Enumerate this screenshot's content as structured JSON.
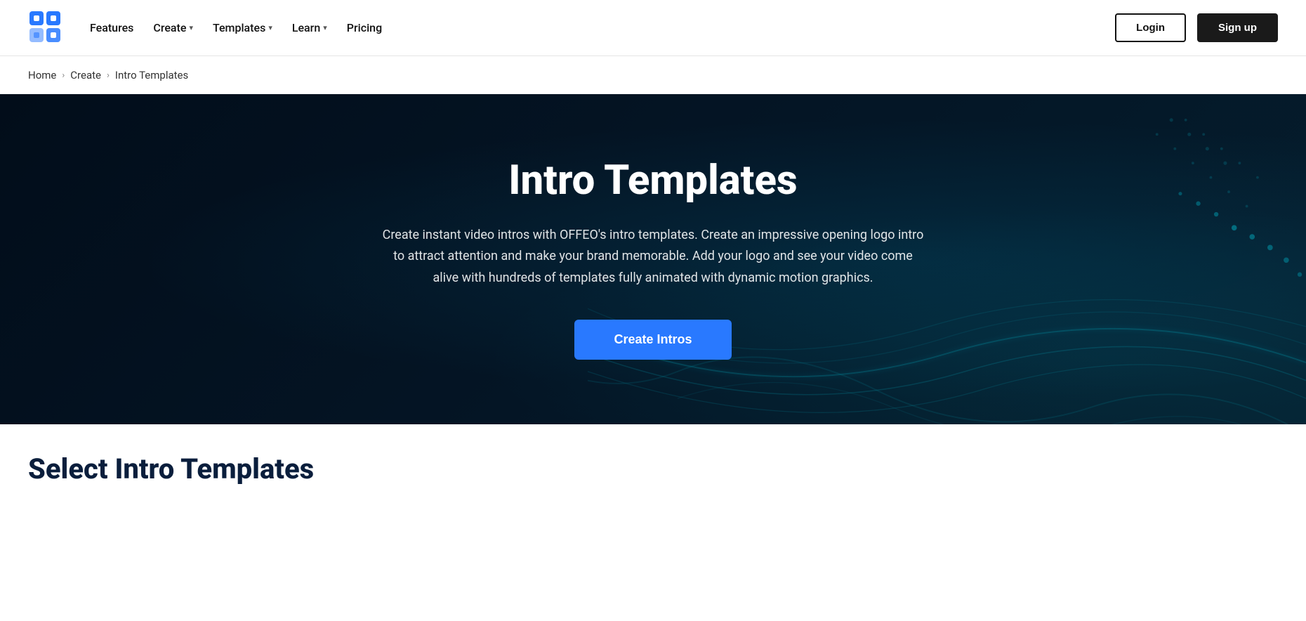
{
  "brand": {
    "name": "OFFEO",
    "logo_colors": [
      "#2979ff",
      "#1a1a2e"
    ]
  },
  "navbar": {
    "features_label": "Features",
    "create_label": "Create",
    "templates_label": "Templates",
    "learn_label": "Learn",
    "pricing_label": "Pricing",
    "login_label": "Login",
    "signup_label": "Sign up"
  },
  "breadcrumb": {
    "home_label": "Home",
    "create_label": "Create",
    "current_label": "Intro Templates"
  },
  "hero": {
    "title": "Intro Templates",
    "description": "Create instant video intros with OFFEO's intro templates. Create an impressive opening logo intro to attract attention and make your brand memorable. Add your logo and see your video come alive with hundreds of templates fully animated with dynamic motion graphics.",
    "cta_label": "Create Intros"
  },
  "below_hero": {
    "section_title": "Select Intro Templates"
  }
}
